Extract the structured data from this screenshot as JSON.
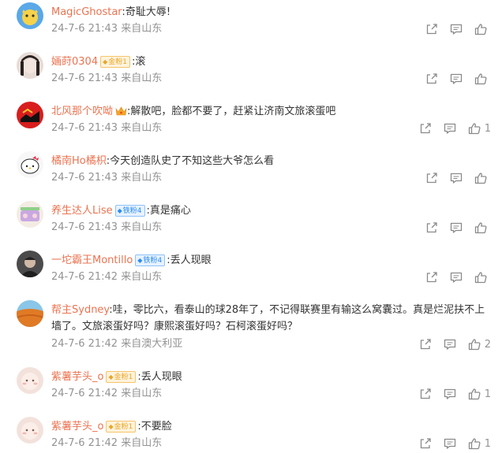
{
  "comments": [
    {
      "username": "MagicGhostar",
      "text": "奇耻大辱!",
      "meta": "24-7-6 21:43 来自山东",
      "likes": ""
    },
    {
      "username": "婳莳0304",
      "badge": "金粉1",
      "text": "滚",
      "meta": "24-7-6 21:43 来自山东",
      "likes": ""
    },
    {
      "username": "北风那个吹呦",
      "text": "解散吧，脸都不要了，赶紧让济南文旅滚蛋吧",
      "meta": "24-7-6 21:43 来自山东",
      "likes": "1"
    },
    {
      "username": "橘南Ho橘枳",
      "text": "今天创造队史了不知这些大爷怎么看",
      "meta": "24-7-6 21:43 来自山东",
      "likes": ""
    },
    {
      "username": "养生达人Lise",
      "badge": "铁粉4",
      "text": "真是痛心",
      "meta": "24-7-6 21:43 来自山东",
      "likes": ""
    },
    {
      "username": "一坨霸王Montillo",
      "badge": "铁粉4",
      "text": "丢人现眼",
      "meta": "24-7-6 21:42 来自山东",
      "likes": ""
    },
    {
      "username": "帮主Sydney",
      "text": "哇，零比六，看泰山的球28年了，不记得联赛里有输这么窝囊过。真是烂泥扶不上墙了。文旅滚蛋好吗？康熙滚蛋好吗？石柯滚蛋好吗？",
      "meta": "24-7-6 21:42 来自澳大利亚",
      "likes": "2"
    },
    {
      "username": "紫薯芋头_o",
      "badge": "金粉1",
      "text": "丢人现眼",
      "meta": "24-7-6 21:42 来自山东",
      "likes": "1"
    },
    {
      "username": "紫薯芋头_o",
      "badge": "金粉1",
      "text": "不要脸",
      "meta": "24-7-6 21:42 来自山东",
      "likes": "1"
    }
  ],
  "icons": {
    "share": "share-icon",
    "reply": "comment-icon",
    "like": "like-icon"
  },
  "colors": {
    "username": "#eb7350",
    "text": "#333333",
    "meta": "#939393",
    "gold_badge": "#e8a72b",
    "iron_badge": "#2d8cf0"
  }
}
